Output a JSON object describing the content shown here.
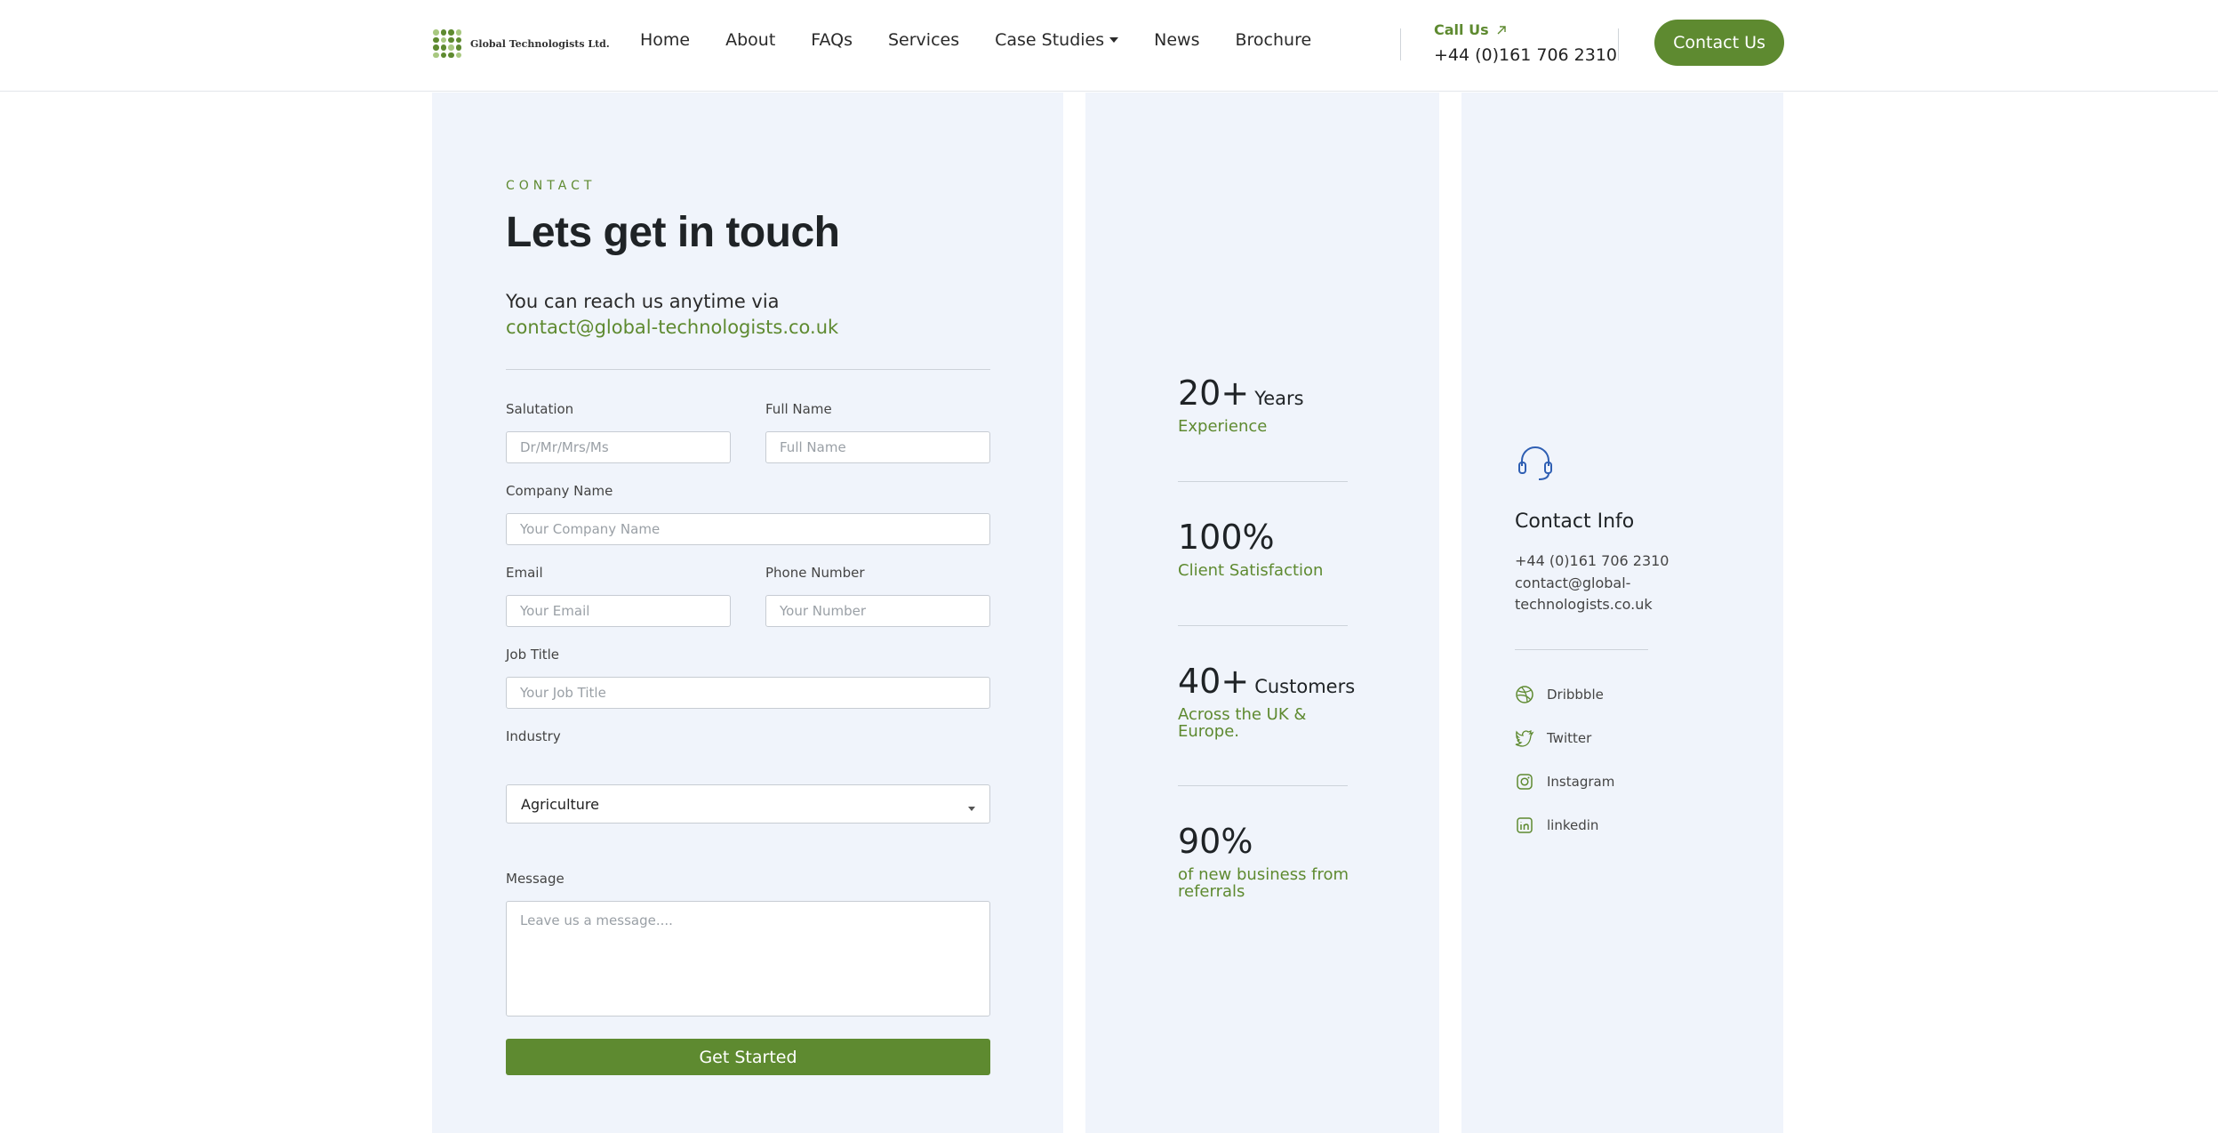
{
  "header": {
    "logo_text": "Global Technologists Ltd.",
    "nav": [
      "Home",
      "About",
      "FAQs",
      "Services",
      "Case Studies",
      "News",
      "Brochure"
    ],
    "call_label": "Call Us",
    "call_number": "+44 (0)161 706 2310",
    "contact_button": "Contact Us"
  },
  "form": {
    "eyebrow": "CONTACT",
    "heading": "Lets get in touch",
    "reach_prefix": "You can reach us anytime via ",
    "reach_email": "contact@global-technologists.co.uk",
    "fields": {
      "salutation": {
        "label": "Salutation",
        "placeholder": "Dr/Mr/Mrs/Ms"
      },
      "full_name": {
        "label": "Full Name",
        "placeholder": "Full Name"
      },
      "company": {
        "label": "Company Name",
        "placeholder": "Your Company Name"
      },
      "email": {
        "label": "Email",
        "placeholder": "Your Email"
      },
      "phone": {
        "label": "Phone Number",
        "placeholder": "Your Number"
      },
      "job_title": {
        "label": "Job Title",
        "placeholder": "Your Job Title"
      },
      "industry": {
        "label": "Industry",
        "value": "Agriculture"
      },
      "message": {
        "label": "Message",
        "placeholder": "Leave us a message...."
      }
    },
    "submit": "Get Started"
  },
  "stats": [
    {
      "value": "20+",
      "unit": "Years",
      "desc": "Experience"
    },
    {
      "value": "100%",
      "unit": "",
      "desc": "Client Satisfaction"
    },
    {
      "value": "40+",
      "unit": "Customers",
      "desc": "Across the UK & Europe."
    },
    {
      "value": "90%",
      "unit": "",
      "desc": "of new business from referrals"
    }
  ],
  "contact_info": {
    "title": "Contact Info",
    "phone": "+44 (0)161 706 2310",
    "email": "contact@global-technologists.co.uk",
    "socials": [
      "Dribbble",
      "Twitter",
      "Instagram",
      "linkedin"
    ]
  },
  "colors": {
    "accent": "#5e8a30",
    "panel": "#f0f4fb",
    "icon_blue": "#2f5fb3"
  }
}
